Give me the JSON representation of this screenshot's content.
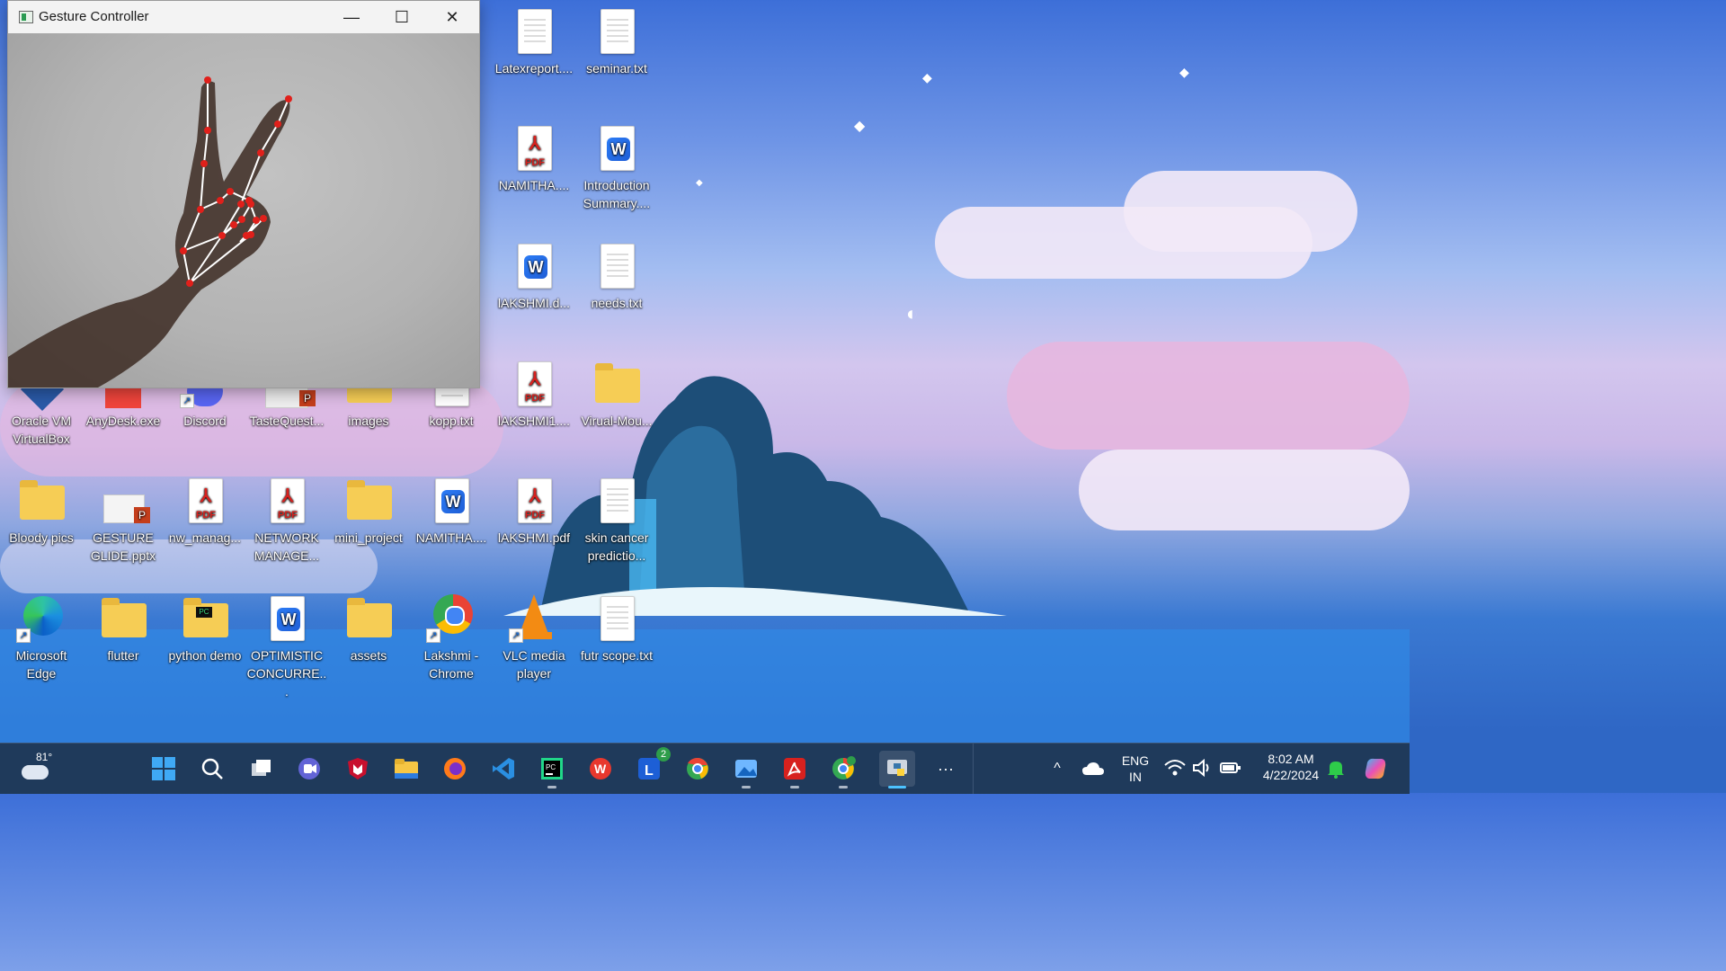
{
  "window": {
    "title": "Gesture Controller",
    "minimize_glyph": "—",
    "maximize_glyph": "☐",
    "close_glyph": "✕"
  },
  "desktop_icons": [
    {
      "label": "Latexreport....",
      "kind": "text"
    },
    {
      "label": "seminar.txt",
      "kind": "text"
    },
    {
      "label": "NAMITHA....",
      "kind": "pdf"
    },
    {
      "label": "Introduction Summary....",
      "kind": "word"
    },
    {
      "label": "lAKSHMI.d...",
      "kind": "word"
    },
    {
      "label": "needs.txt",
      "kind": "text"
    },
    {
      "label": "Oracle VM VirtualBox",
      "kind": "app"
    },
    {
      "label": "AnyDesk.exe",
      "kind": "app"
    },
    {
      "label": "Discord",
      "kind": "app"
    },
    {
      "label": "TasteQuest...",
      "kind": "pptx"
    },
    {
      "label": "images",
      "kind": "folder"
    },
    {
      "label": "kopp.txt",
      "kind": "text"
    },
    {
      "label": "lAKSHMI1....",
      "kind": "pdf"
    },
    {
      "label": "Virual-Mou...",
      "kind": "folder"
    },
    {
      "label": "Bloody pics",
      "kind": "folder"
    },
    {
      "label": "GESTURE GLIDE.pptx",
      "kind": "pptx"
    },
    {
      "label": "nw_manag...",
      "kind": "pdf"
    },
    {
      "label": "NETWORK MANAGE...",
      "kind": "pdf"
    },
    {
      "label": "mini_project",
      "kind": "folder"
    },
    {
      "label": "NAMITHA....",
      "kind": "word"
    },
    {
      "label": "lAKSHMI.pdf",
      "kind": "pdf"
    },
    {
      "label": "skin cancer predictio...",
      "kind": "text"
    },
    {
      "label": "Microsoft Edge",
      "kind": "edge"
    },
    {
      "label": "flutter",
      "kind": "folder"
    },
    {
      "label": "python demo",
      "kind": "folder"
    },
    {
      "label": "OPTIMISTIC CONCURRE...",
      "kind": "word"
    },
    {
      "label": "assets",
      "kind": "folder"
    },
    {
      "label": "Lakshmi - Chrome",
      "kind": "chrome"
    },
    {
      "label": "VLC media player",
      "kind": "vlc"
    },
    {
      "label": "futr scope.txt",
      "kind": "text"
    }
  ],
  "taskbar": {
    "weather_temp": "81°",
    "apps": [
      {
        "name": "start"
      },
      {
        "name": "search"
      },
      {
        "name": "task-view"
      },
      {
        "name": "teams"
      },
      {
        "name": "mcafee"
      },
      {
        "name": "file-explorer"
      },
      {
        "name": "firefox"
      },
      {
        "name": "vscode"
      },
      {
        "name": "pycharm"
      },
      {
        "name": "wps"
      },
      {
        "name": "l-app",
        "badge": "2"
      },
      {
        "name": "chrome"
      },
      {
        "name": "photos"
      },
      {
        "name": "acrobat"
      },
      {
        "name": "chrome-profile"
      },
      {
        "name": "python"
      }
    ],
    "more_glyph": "···",
    "tray_chevron": "^",
    "language_line1": "ENG",
    "language_line2": "IN",
    "time": "8:02 AM",
    "date": "4/22/2024"
  },
  "colors": {
    "taskbar_bg": "#1f3a5b",
    "landmark_red": "#e0201b",
    "pdf_red": "#d7211e",
    "word_blue": "#2c7cf6",
    "folder_yellow": "#f6cd55"
  }
}
